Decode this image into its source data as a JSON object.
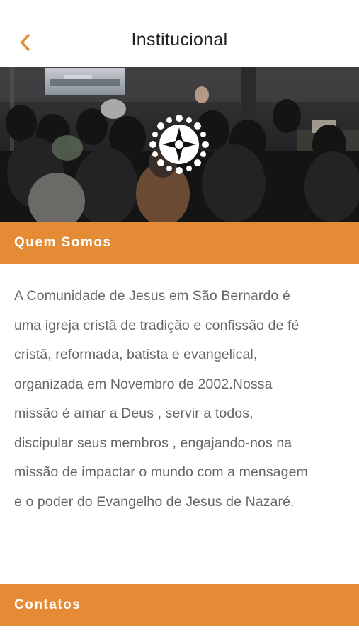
{
  "navbar": {
    "title": "Institucional",
    "back_icon": "chevron-left-icon",
    "accent_color": "#e58a35"
  },
  "hero": {
    "image_description_icon": "church-logo-icon"
  },
  "about": {
    "header": "Quem Somos",
    "text": "A Comunidade de Jesus  em São Bernardo é\numa igreja cristã de tradição e confissão de fé\ncristã, reformada, batista e evangelical,\norganizada  em Novembro de 2002.Nossa\nmissão é amar a Deus , servir a todos,\ndiscipular seus membros , engajando-nos na\nmissão de impactar o mundo com a mensagem\ne o poder do Evangelho de Jesus de Nazaré."
  },
  "contacts": {
    "header": "Contatos"
  },
  "colors": {
    "section_header_bg": "#e58a35",
    "body_text": "#666666",
    "title_text": "#222222"
  }
}
